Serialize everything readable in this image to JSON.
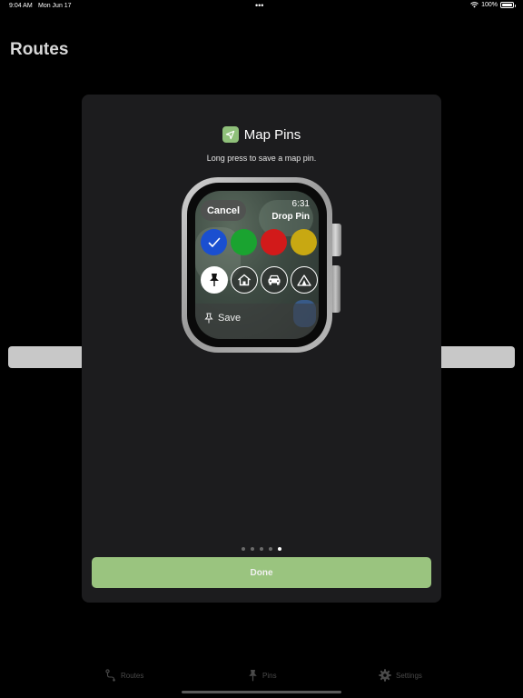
{
  "status_bar": {
    "time": "9:04 AM",
    "date": "Mon Jun 17",
    "dots": "•••",
    "battery_percent": "100%"
  },
  "page": {
    "title": "Routes"
  },
  "modal": {
    "title": "Map Pins",
    "subtitle": "Long press to save a map pin.",
    "app_icon": "location-arrow-icon",
    "done_label": "Done",
    "pager": {
      "count": 5,
      "active_index": 4
    }
  },
  "watch": {
    "cancel_label": "Cancel",
    "time": "6:31",
    "heading": "Drop Pin",
    "colors": [
      {
        "name": "blue",
        "hex": "#1a4fd0",
        "selected": true
      },
      {
        "name": "green",
        "hex": "#1aa330",
        "selected": false
      },
      {
        "name": "red",
        "hex": "#d21a1a",
        "selected": false
      },
      {
        "name": "yellow",
        "hex": "#c8a812",
        "selected": false
      }
    ],
    "icons": [
      {
        "name": "pushpin-icon",
        "selected": true
      },
      {
        "name": "house-icon",
        "selected": false
      },
      {
        "name": "car-icon",
        "selected": false
      },
      {
        "name": "tent-icon",
        "selected": false
      }
    ],
    "save_label": "Save"
  },
  "tab_bar": {
    "items": [
      {
        "label": "Routes",
        "icon": "route-icon"
      },
      {
        "label": "Pins",
        "icon": "pushpin-icon"
      },
      {
        "label": "Settings",
        "icon": "gear-icon"
      }
    ]
  },
  "colors": {
    "accent": "#9ac47f",
    "modal_bg": "#1c1c1e"
  }
}
